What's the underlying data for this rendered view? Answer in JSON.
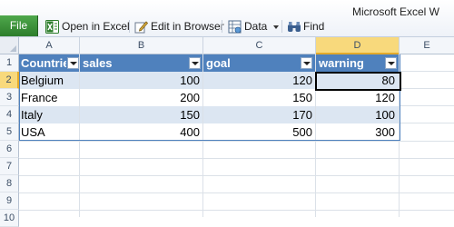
{
  "app": {
    "title": "Microsoft Excel W"
  },
  "toolbar": {
    "file_label": "File",
    "open_in_excel": "Open in Excel",
    "edit_in_browser": "Edit in Browser",
    "data": "Data",
    "find": "Find"
  },
  "columns": [
    "A",
    "B",
    "C",
    "D",
    "E"
  ],
  "selected_column": "D",
  "rows": [
    "1",
    "2",
    "3",
    "4",
    "5",
    "6",
    "7",
    "8",
    "9",
    "10"
  ],
  "selected_row": "2",
  "table": {
    "headers": [
      "Countries",
      "sales",
      "goal",
      "warning"
    ],
    "rows": [
      [
        "Belgium",
        "100",
        "120",
        "80"
      ],
      [
        "France",
        "200",
        "150",
        "120"
      ],
      [
        "Italy",
        "150",
        "170",
        "100"
      ],
      [
        "USA",
        "400",
        "500",
        "300"
      ]
    ]
  },
  "colors": {
    "table_header": "#4f81bd",
    "band": "#dce6f2",
    "selection": "#f8d97c",
    "file_button": "#3a8f37"
  }
}
